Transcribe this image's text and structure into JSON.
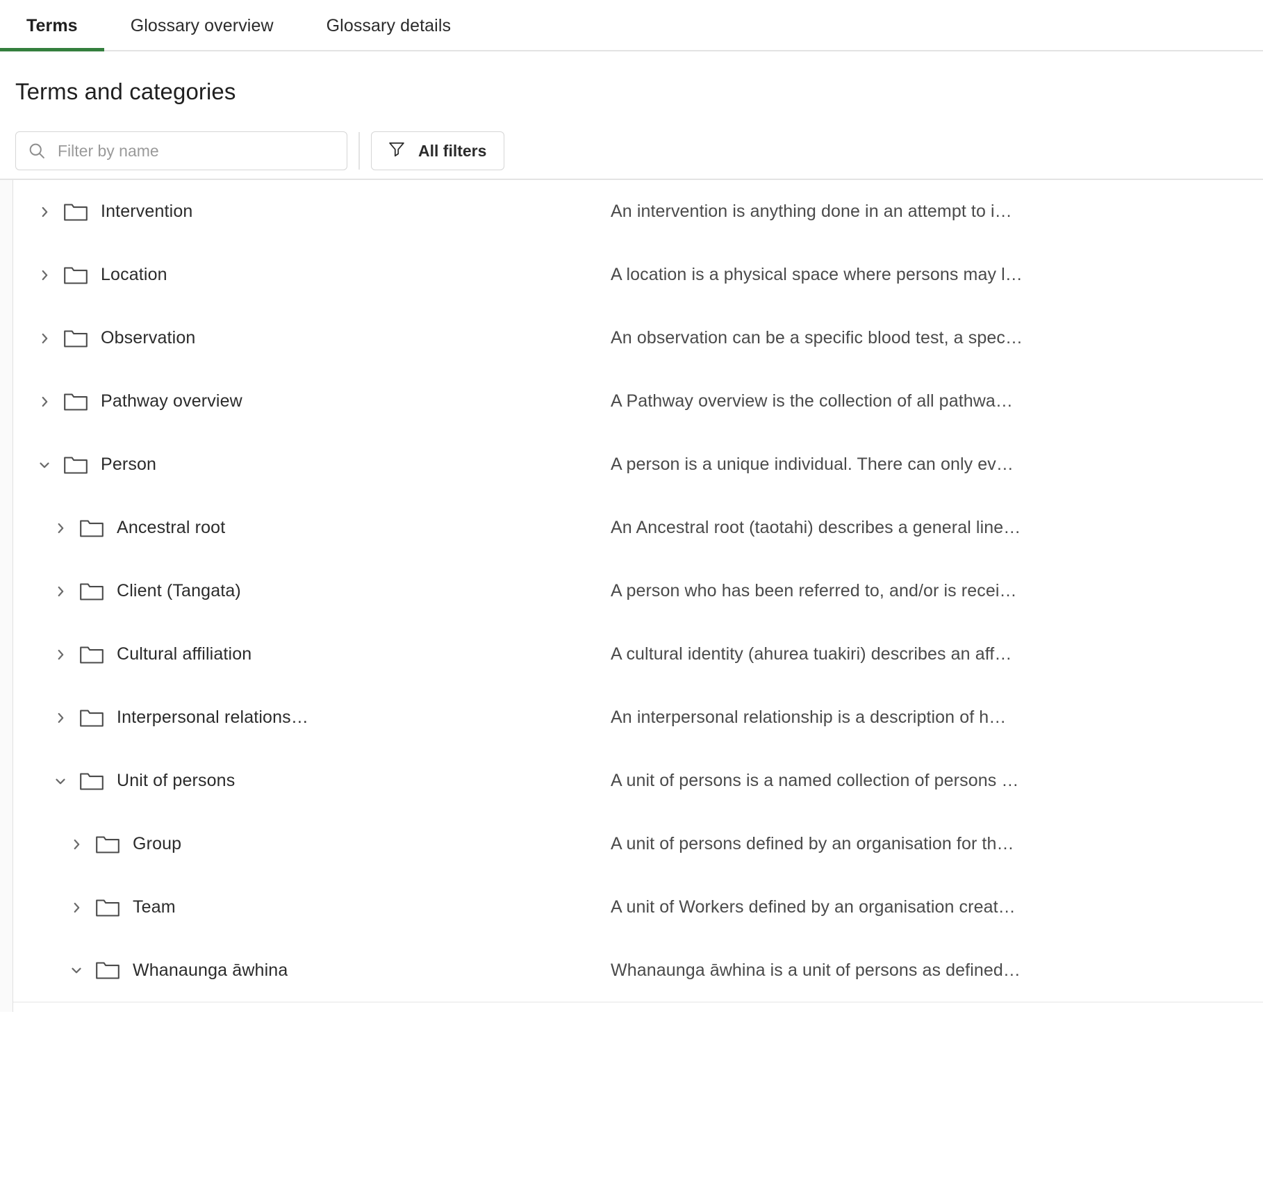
{
  "tabs": [
    {
      "label": "Terms",
      "active": true
    },
    {
      "label": "Glossary overview",
      "active": false
    },
    {
      "label": "Glossary details",
      "active": false
    }
  ],
  "page": {
    "title": "Terms and categories"
  },
  "search": {
    "placeholder": "Filter by name",
    "value": "",
    "icon": "search-icon"
  },
  "filters": {
    "button_label": "All filters",
    "icon": "funnel-icon"
  },
  "colors": {
    "active_tab_underline": "#347f3e",
    "border": "#e3e3e3",
    "text": "#2b2b2b",
    "muted_text": "#9a9a9a"
  },
  "tree": {
    "rows": [
      {
        "name": "Intervention",
        "description": "An intervention is anything done in an attempt to i…",
        "level": 0,
        "expanded": false
      },
      {
        "name": "Location",
        "description": "A location is a physical space where persons may l…",
        "level": 0,
        "expanded": false
      },
      {
        "name": "Observation",
        "description": "An observation can be a specific blood test, a spec…",
        "level": 0,
        "expanded": false
      },
      {
        "name": "Pathway overview",
        "description": "A Pathway overview is the collection of all pathwa…",
        "level": 0,
        "expanded": false
      },
      {
        "name": "Person",
        "description": "A person is a unique individual. There can only ev…",
        "level": 0,
        "expanded": true
      },
      {
        "name": "Ancestral root",
        "description": "An Ancestral root (taotahi) describes a general line…",
        "level": 1,
        "expanded": false
      },
      {
        "name": "Client (Tangata)",
        "description": "A person who has been referred to, and/or is recei…",
        "level": 1,
        "expanded": false
      },
      {
        "name": "Cultural affiliation",
        "description": "A cultural identity (ahurea tuakiri) describes an aff…",
        "level": 1,
        "expanded": false
      },
      {
        "name": "Interpersonal relations…",
        "description": "An interpersonal relationship is a description of h…",
        "level": 1,
        "expanded": false
      },
      {
        "name": "Unit of persons",
        "description": "A unit of persons is a named collection of persons …",
        "level": 1,
        "expanded": true
      },
      {
        "name": "Group",
        "description": "A unit of persons defined by an organisation for th…",
        "level": 2,
        "expanded": false
      },
      {
        "name": "Team",
        "description": "A unit of Workers defined by an organisation creat…",
        "level": 2,
        "expanded": false
      },
      {
        "name": "Whanaunga āwhina",
        "description": "Whanaunga āwhina is a unit of persons as defined…",
        "level": 2,
        "expanded": true
      }
    ]
  }
}
